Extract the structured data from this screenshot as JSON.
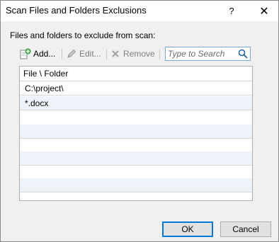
{
  "window": {
    "title": "Scan Files and Folders Exclusions",
    "help_label": "?",
    "close_label": "✕"
  },
  "group_label": "Files and folders to exclude from scan:",
  "toolbar": {
    "add_label": "Add...",
    "edit_label": "Edit...",
    "remove_label": "Remove",
    "add_icon": "add-icon",
    "edit_icon": "pencil-icon",
    "remove_icon": "remove-x-icon"
  },
  "search": {
    "placeholder": "Type to Search",
    "icon": "search-icon"
  },
  "list": {
    "header": "File \\ Folder",
    "items": [
      "C:\\project\\",
      "*.docx"
    ]
  },
  "buttons": {
    "ok": "OK",
    "cancel": "Cancel"
  },
  "colors": {
    "accent": "#0078d7",
    "alt_row": "#eef3fa",
    "dialog_bg": "#f0f0f0"
  }
}
